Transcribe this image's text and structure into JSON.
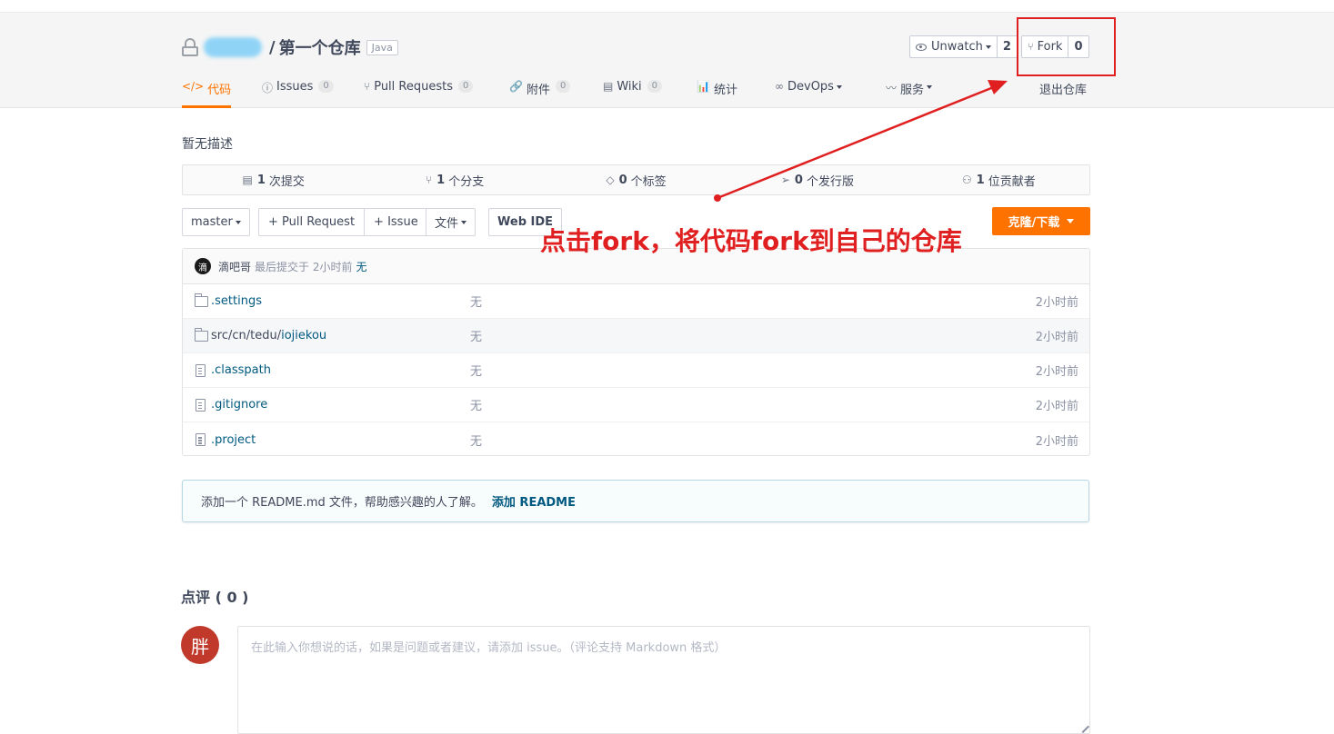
{
  "repo": {
    "name": "第一个仓库",
    "language": "Java"
  },
  "actions": {
    "watch_label": "Unwatch",
    "watch_count": "2",
    "fork_label": "Fork",
    "fork_count": "0"
  },
  "tabs": [
    {
      "label": "代码",
      "icon": "</>"
    },
    {
      "label": "Issues",
      "count": "0",
      "icon": "ⓘ"
    },
    {
      "label": "Pull Requests",
      "count": "0",
      "icon": "⑂"
    },
    {
      "label": "附件",
      "count": "0",
      "icon": "🔗"
    },
    {
      "label": "Wiki",
      "count": "0",
      "icon": "▤"
    },
    {
      "label": "统计",
      "icon": "📊"
    },
    {
      "label": "DevOps",
      "icon": "∞"
    },
    {
      "label": "服务",
      "icon": "〰"
    }
  ],
  "exit_label": "退出仓库",
  "description": "暂无描述",
  "stats": [
    {
      "value": "1",
      "label": "次提交"
    },
    {
      "value": "1",
      "label": "个分支"
    },
    {
      "value": "0",
      "label": "个标签"
    },
    {
      "value": "0",
      "label": "个发行版"
    },
    {
      "value": "1",
      "label": "位贡献者"
    }
  ],
  "toolbar": {
    "branch": "master",
    "pull_request": "+ Pull Request",
    "issue": "+ Issue",
    "file": "文件",
    "web_ide": "Web IDE",
    "clone": "克隆/下载"
  },
  "last_commit": {
    "avatar_char": "滴",
    "author": "滴吧哥",
    "info": "最后提交于 2小时前",
    "message": "无"
  },
  "files": [
    {
      "type": "folder",
      "prefix": "",
      "name": ".settings",
      "message": "无",
      "time": "2小时前"
    },
    {
      "type": "folder",
      "prefix": "src/cn/tedu/",
      "name": "iojiekou",
      "message": "无",
      "time": "2小时前"
    },
    {
      "type": "file",
      "prefix": "",
      "name": ".classpath",
      "message": "无",
      "time": "2小时前"
    },
    {
      "type": "file",
      "prefix": "",
      "name": ".gitignore",
      "message": "无",
      "time": "2小时前"
    },
    {
      "type": "file",
      "prefix": "",
      "name": ".project",
      "message": "无",
      "time": "2小时前"
    }
  ],
  "readme_tip": {
    "text": "添加一个 README.md 文件，帮助感兴趣的人了解。",
    "link": "添加 README"
  },
  "review": {
    "title": "点评 ( 0 )",
    "avatar_char": "胖",
    "placeholder": "在此输入你想说的话，如果是问题或者建议，请添加 issue。（评论支持 Markdown 格式）"
  },
  "annotation": {
    "text": "点击fork，将代码fork到自己的仓库",
    "color": "#e02020"
  },
  "colors": {
    "accent": "#fe7300",
    "link": "#005980"
  }
}
